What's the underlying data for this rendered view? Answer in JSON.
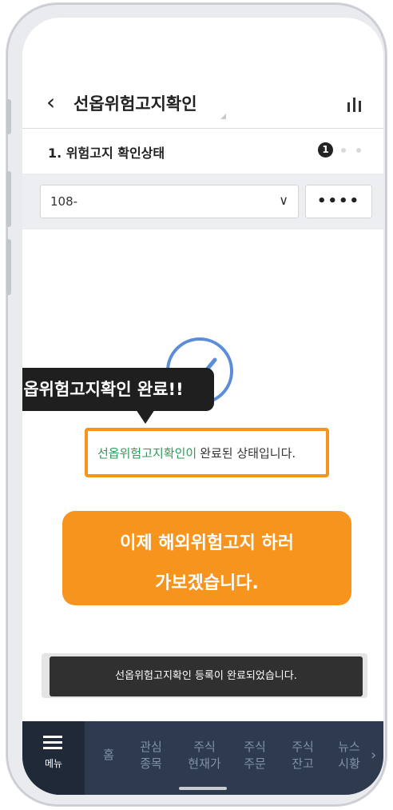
{
  "header": {
    "title": "선옵위험고지확인"
  },
  "section": {
    "title": "1. 위험고지 확인상태",
    "step_number": "1"
  },
  "account": {
    "value": "108-",
    "password_mask": "••••"
  },
  "tooltip": {
    "text": "선옵위험고지확인 완료!!"
  },
  "status": {
    "highlight": "선옵위험고지확인이",
    "rest": "완료된 상태입니다."
  },
  "next_card": {
    "line1": "이제 해외위험고지 하러",
    "line2": "가보겠습니다."
  },
  "toast": {
    "text": "선옵위험고지확인 등록이 완료되었습니다."
  },
  "bottom_nav": {
    "menu_label": "메뉴",
    "items": [
      {
        "line1": "홈",
        "line2": ""
      },
      {
        "line1": "관심",
        "line2": "종목"
      },
      {
        "line1": "주식",
        "line2": "현재가"
      },
      {
        "line1": "주식",
        "line2": "주문"
      },
      {
        "line1": "주식",
        "line2": "잔고"
      },
      {
        "line1": "뉴스",
        "line2": "시황"
      }
    ]
  },
  "colors": {
    "accent_orange": "#f7941d",
    "success_green": "#2f9a57",
    "check_blue": "#5b8ed6",
    "nav_bg": "#2e3a4d"
  }
}
